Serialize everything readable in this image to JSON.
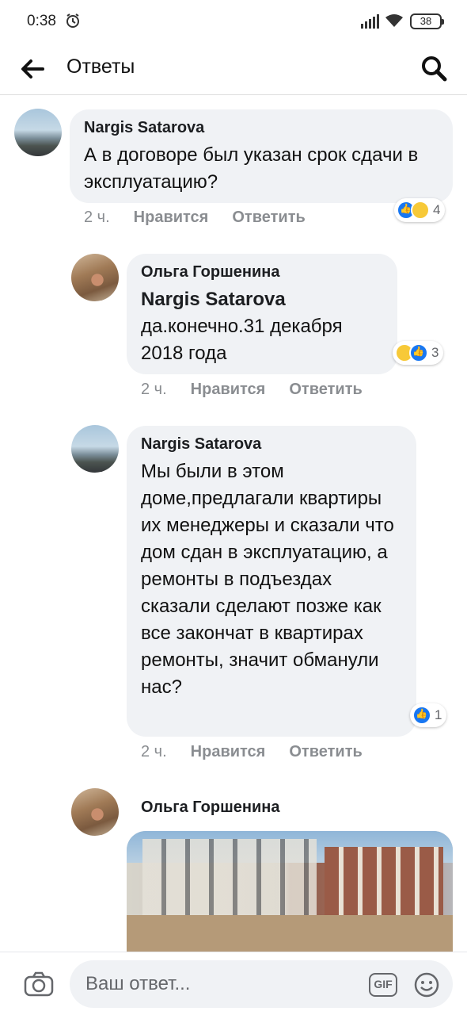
{
  "status_bar": {
    "time": "0:38",
    "battery": "38"
  },
  "header": {
    "title": "Ответы"
  },
  "comments": [
    {
      "author": "Nargis Satarova",
      "text": "А в договоре был указан срок сдачи в эксплуатацию?",
      "time": "2 ч.",
      "like_label": "Нравится",
      "reply_label": "Ответить",
      "reaction_count": "4",
      "reactions": [
        "like-icon",
        "haha-icon"
      ]
    },
    {
      "author": "Ольга Горшенина",
      "mention": "Nargis Satarova",
      "text": "да.конечно.31 декабря 2018 года",
      "time": "2 ч.",
      "like_label": "Нравится",
      "reply_label": "Ответить",
      "reaction_count": "3",
      "reactions": [
        "wow-icon",
        "like-icon"
      ]
    },
    {
      "author": "Nargis Satarova",
      "text": "Мы были в этом доме,предлагали квартиры их менеджеры и сказали что дом сдан в эксплуатацию, а ремонты в подъездах сказали сделают позже как все закончат в квартирах ремонты, значит обманули нас?",
      "time": "2 ч.",
      "like_label": "Нравится",
      "reply_label": "Ответить",
      "reaction_count": "1",
      "reactions": [
        "like-icon"
      ]
    },
    {
      "author": "Ольга Горшенина",
      "attachment": "photo"
    }
  ],
  "composer": {
    "placeholder": "Ваш ответ...",
    "gif_label": "GIF"
  },
  "colors": {
    "bubble": "#f0f2f5",
    "meta": "#8a8d91",
    "like": "#1877f2",
    "haha": "#f7c938"
  }
}
